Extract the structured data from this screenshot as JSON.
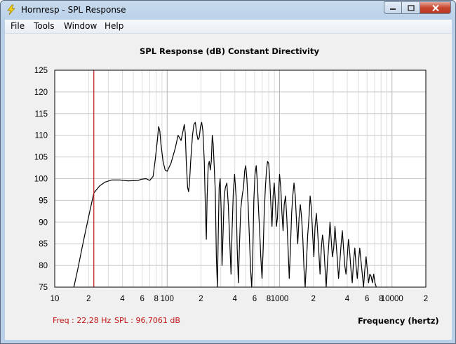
{
  "window": {
    "title": "Hornresp - SPL Response",
    "icon": "lightning-bolt-icon"
  },
  "menu": [
    {
      "label": "File"
    },
    {
      "label": "Tools"
    },
    {
      "label": "Window"
    },
    {
      "label": "Help"
    }
  ],
  "chart_title": "SPL Response (dB)   Constant Directivity",
  "readout": {
    "freq": "Freq : 22,28 Hz",
    "spl": "SPL : 96,7061 dB",
    "color": "#c01818"
  },
  "chart_data": {
    "type": "line",
    "title": "SPL Response (dB)   Constant Directivity",
    "xlabel": "Frequency (hertz)",
    "ylabel": "",
    "x_scale": "log",
    "xlim": [
      10,
      20000
    ],
    "ylim": [
      75,
      125
    ],
    "grid": true,
    "y_ticks": [
      "125",
      "120",
      "115",
      "110",
      "105",
      "100",
      "95",
      "90",
      "85",
      "80",
      "75"
    ],
    "x_ticks": [
      {
        "value": 10,
        "label": "10"
      },
      {
        "value": 20,
        "label": "2"
      },
      {
        "value": 40,
        "label": "4"
      },
      {
        "value": 60,
        "label": "6"
      },
      {
        "value": 80,
        "label": "8"
      },
      {
        "value": 100,
        "label": "100"
      },
      {
        "value": 200,
        "label": "2"
      },
      {
        "value": 400,
        "label": "4"
      },
      {
        "value": 600,
        "label": "6"
      },
      {
        "value": 800,
        "label": "8"
      },
      {
        "value": 1000,
        "label": "1000"
      },
      {
        "value": 2000,
        "label": "2"
      },
      {
        "value": 4000,
        "label": "4"
      },
      {
        "value": 6000,
        "label": "6"
      },
      {
        "value": 8000,
        "label": "8"
      },
      {
        "value": 10000,
        "label": "10000"
      },
      {
        "value": 20000,
        "label": "2"
      }
    ],
    "cursor": {
      "x": 22.28,
      "y": 96.7061,
      "color": "#c01818"
    },
    "series": [
      {
        "color": "#000000",
        "points": [
          [
            14.8,
            75
          ],
          [
            16,
            79
          ],
          [
            17.5,
            84
          ],
          [
            19,
            88.5
          ],
          [
            20.5,
            92.5
          ],
          [
            22.3,
            96.7
          ],
          [
            25,
            98.3
          ],
          [
            28,
            99.2
          ],
          [
            32,
            99.7
          ],
          [
            38,
            99.7
          ],
          [
            45,
            99.5
          ],
          [
            55,
            99.6
          ],
          [
            60,
            99.9
          ],
          [
            65,
            100
          ],
          [
            70,
            99.6
          ],
          [
            75,
            100.5
          ],
          [
            78,
            104
          ],
          [
            82,
            109
          ],
          [
            84,
            112
          ],
          [
            86,
            111
          ],
          [
            88,
            108
          ],
          [
            92,
            104
          ],
          [
            96,
            102
          ],
          [
            100,
            101.7
          ],
          [
            108,
            103.5
          ],
          [
            118,
            107
          ],
          [
            125,
            110
          ],
          [
            133,
            108.8
          ],
          [
            138,
            110.8
          ],
          [
            142,
            112.5
          ],
          [
            145,
            110.5
          ],
          [
            148,
            104
          ],
          [
            152,
            98
          ],
          [
            155,
            97
          ],
          [
            158,
            99
          ],
          [
            162,
            104
          ],
          [
            168,
            110
          ],
          [
            173,
            112.5
          ],
          [
            178,
            113
          ],
          [
            183,
            110.5
          ],
          [
            188,
            109
          ],
          [
            193,
            109.5
          ],
          [
            198,
            112
          ],
          [
            203,
            113
          ],
          [
            208,
            111
          ],
          [
            214,
            104
          ],
          [
            219,
            93
          ],
          [
            223,
            86
          ],
          [
            227,
            96
          ],
          [
            232,
            103
          ],
          [
            237,
            104
          ],
          [
            242,
            102
          ],
          [
            247,
            104
          ],
          [
            252,
            110
          ],
          [
            257,
            108
          ],
          [
            262,
            103
          ],
          [
            268,
            97
          ],
          [
            274,
            82
          ],
          [
            280,
            75
          ],
          [
            285,
            87
          ],
          [
            290,
            98
          ],
          [
            296,
            100
          ],
          [
            302,
            93
          ],
          [
            308,
            80
          ],
          [
            315,
            88
          ],
          [
            322,
            96
          ],
          [
            330,
            98
          ],
          [
            340,
            99
          ],
          [
            350,
            94
          ],
          [
            360,
            86
          ],
          [
            370,
            78
          ],
          [
            378,
            88
          ],
          [
            388,
            97
          ],
          [
            398,
            101
          ],
          [
            410,
            96
          ],
          [
            420,
            84
          ],
          [
            430,
            76
          ],
          [
            440,
            85
          ],
          [
            452,
            93
          ],
          [
            465,
            96
          ],
          [
            478,
            98
          ],
          [
            490,
            102
          ],
          [
            500,
            103
          ],
          [
            512,
            100
          ],
          [
            525,
            94
          ],
          [
            540,
            86
          ],
          [
            552,
            79
          ],
          [
            565,
            75
          ],
          [
            578,
            83
          ],
          [
            590,
            95
          ],
          [
            605,
            101
          ],
          [
            620,
            103
          ],
          [
            635,
            99
          ],
          [
            650,
            93
          ],
          [
            665,
            88
          ],
          [
            680,
            82
          ],
          [
            698,
            77
          ],
          [
            715,
            84
          ],
          [
            730,
            92
          ],
          [
            748,
            98
          ],
          [
            765,
            102
          ],
          [
            782,
            104
          ],
          [
            800,
            103.5
          ],
          [
            818,
            100
          ],
          [
            837,
            94
          ],
          [
            856,
            89
          ],
          [
            876,
            96
          ],
          [
            896,
            99
          ],
          [
            916,
            95
          ],
          [
            937,
            89
          ],
          [
            958,
            91
          ],
          [
            980,
            97
          ],
          [
            1000,
            101
          ],
          [
            1025,
            98
          ],
          [
            1050,
            92
          ],
          [
            1075,
            88
          ],
          [
            1100,
            94
          ],
          [
            1130,
            96
          ],
          [
            1160,
            91
          ],
          [
            1190,
            84
          ],
          [
            1220,
            77
          ],
          [
            1250,
            84
          ],
          [
            1280,
            92
          ],
          [
            1310,
            96
          ],
          [
            1345,
            99
          ],
          [
            1380,
            96
          ],
          [
            1415,
            90
          ],
          [
            1450,
            85
          ],
          [
            1490,
            91
          ],
          [
            1530,
            94
          ],
          [
            1570,
            91
          ],
          [
            1610,
            86
          ],
          [
            1650,
            79
          ],
          [
            1690,
            75
          ],
          [
            1735,
            81
          ],
          [
            1780,
            87
          ],
          [
            1825,
            91
          ],
          [
            1870,
            96
          ],
          [
            1920,
            93
          ],
          [
            1970,
            87
          ],
          [
            2020,
            82
          ],
          [
            2070,
            89
          ],
          [
            2125,
            92
          ],
          [
            2180,
            88
          ],
          [
            2235,
            83
          ],
          [
            2290,
            78
          ],
          [
            2350,
            84
          ],
          [
            2410,
            87
          ],
          [
            2470,
            85
          ],
          [
            2530,
            80
          ],
          [
            2600,
            75
          ],
          [
            2670,
            81
          ],
          [
            2740,
            85
          ],
          [
            2810,
            90
          ],
          [
            2880,
            86
          ],
          [
            2950,
            82
          ],
          [
            3030,
            84
          ],
          [
            3110,
            89
          ],
          [
            3190,
            85
          ],
          [
            3270,
            81
          ],
          [
            3350,
            77
          ],
          [
            3440,
            81
          ],
          [
            3530,
            85
          ],
          [
            3620,
            88
          ],
          [
            3710,
            84
          ],
          [
            3800,
            80
          ],
          [
            3900,
            78
          ],
          [
            4000,
            82
          ],
          [
            4100,
            86
          ],
          [
            4210,
            83
          ],
          [
            4320,
            79
          ],
          [
            4430,
            76
          ],
          [
            4550,
            81
          ],
          [
            4670,
            84
          ],
          [
            4790,
            80
          ],
          [
            4910,
            77
          ],
          [
            5040,
            81
          ],
          [
            5170,
            84
          ],
          [
            5300,
            81
          ],
          [
            5440,
            78
          ],
          [
            5580,
            75
          ],
          [
            5730,
            79
          ],
          [
            5880,
            82
          ],
          [
            6030,
            79
          ],
          [
            6190,
            76
          ],
          [
            6350,
            78
          ],
          [
            6520,
            77.5
          ],
          [
            6700,
            76
          ],
          [
            6880,
            78
          ],
          [
            7060,
            76
          ],
          [
            7250,
            75
          ]
        ]
      }
    ]
  }
}
